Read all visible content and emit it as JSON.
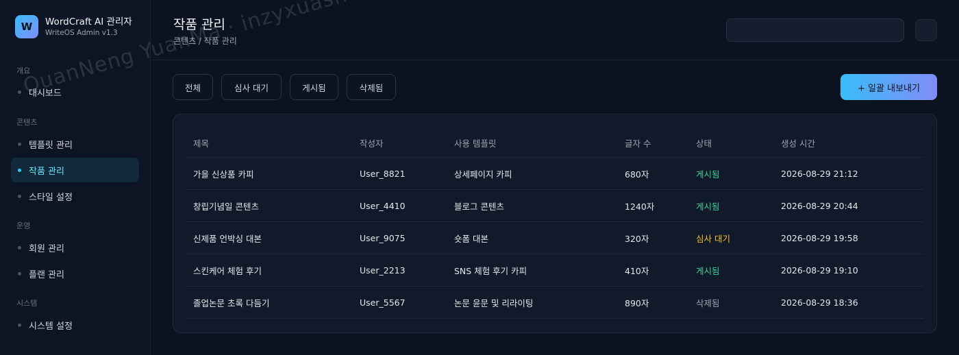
{
  "brand": {
    "logo_letter": "W",
    "title": "WordCraft AI 관리자",
    "subtitle": "WriteOS Admin v1.3"
  },
  "sidebar": {
    "sections": [
      {
        "label": "개요",
        "items": [
          {
            "label": "대시보드",
            "active": false
          }
        ]
      },
      {
        "label": "콘텐츠",
        "items": [
          {
            "label": "템플릿 관리",
            "active": false
          },
          {
            "label": "작품 관리",
            "active": true
          },
          {
            "label": "스타일 설정",
            "active": false
          }
        ]
      },
      {
        "label": "운영",
        "items": [
          {
            "label": "회원 관리",
            "active": false
          },
          {
            "label": "플랜 관리",
            "active": false
          }
        ]
      },
      {
        "label": "시스템",
        "items": [
          {
            "label": "시스템 설정",
            "active": false
          }
        ]
      }
    ]
  },
  "header": {
    "title": "작품 관리",
    "breadcrumb": "콘텐츠 / 작품 관리",
    "search_value": ""
  },
  "filters": {
    "tabs": [
      "전체",
      "심사 대기",
      "게시됨",
      "삭제됨"
    ],
    "export_label": "+ 일괄 내보내기"
  },
  "table": {
    "columns": [
      "제목",
      "작성자",
      "사용 템플릿",
      "글자 수",
      "상태",
      "생성 시간"
    ],
    "rows": [
      [
        "가을 신상품 카피",
        "User_8821",
        "상세페이지 카피",
        "680자",
        "게시됨",
        "2026-08-29 21:12"
      ],
      [
        "창립기념일 콘텐츠",
        "User_4410",
        "블로그 콘텐츠",
        "1240자",
        "게시됨",
        "2026-08-29 20:44"
      ],
      [
        "신제품 언박싱 대본",
        "User_9075",
        "숏폼 대본",
        "320자",
        "심사 대기",
        "2026-08-29 19:58"
      ],
      [
        "스킨케어 체험 후기",
        "User_2213",
        "SNS 체험 후기 카피",
        "410자",
        "게시됨",
        "2026-08-29 19:10"
      ],
      [
        "졸업논문 초록 다듬기",
        "User_5567",
        "논문 윤문 및 리라이팅",
        "890자",
        "삭제됨",
        "2026-08-29 18:36"
      ]
    ]
  },
  "status_colors": {
    "게시됨": "#34d399",
    "심사 대기": "#fbbf24",
    "삭제됨": "#9ca3af"
  },
  "watermark": "QuanNeng YuanMa · inzyxuashop.com"
}
